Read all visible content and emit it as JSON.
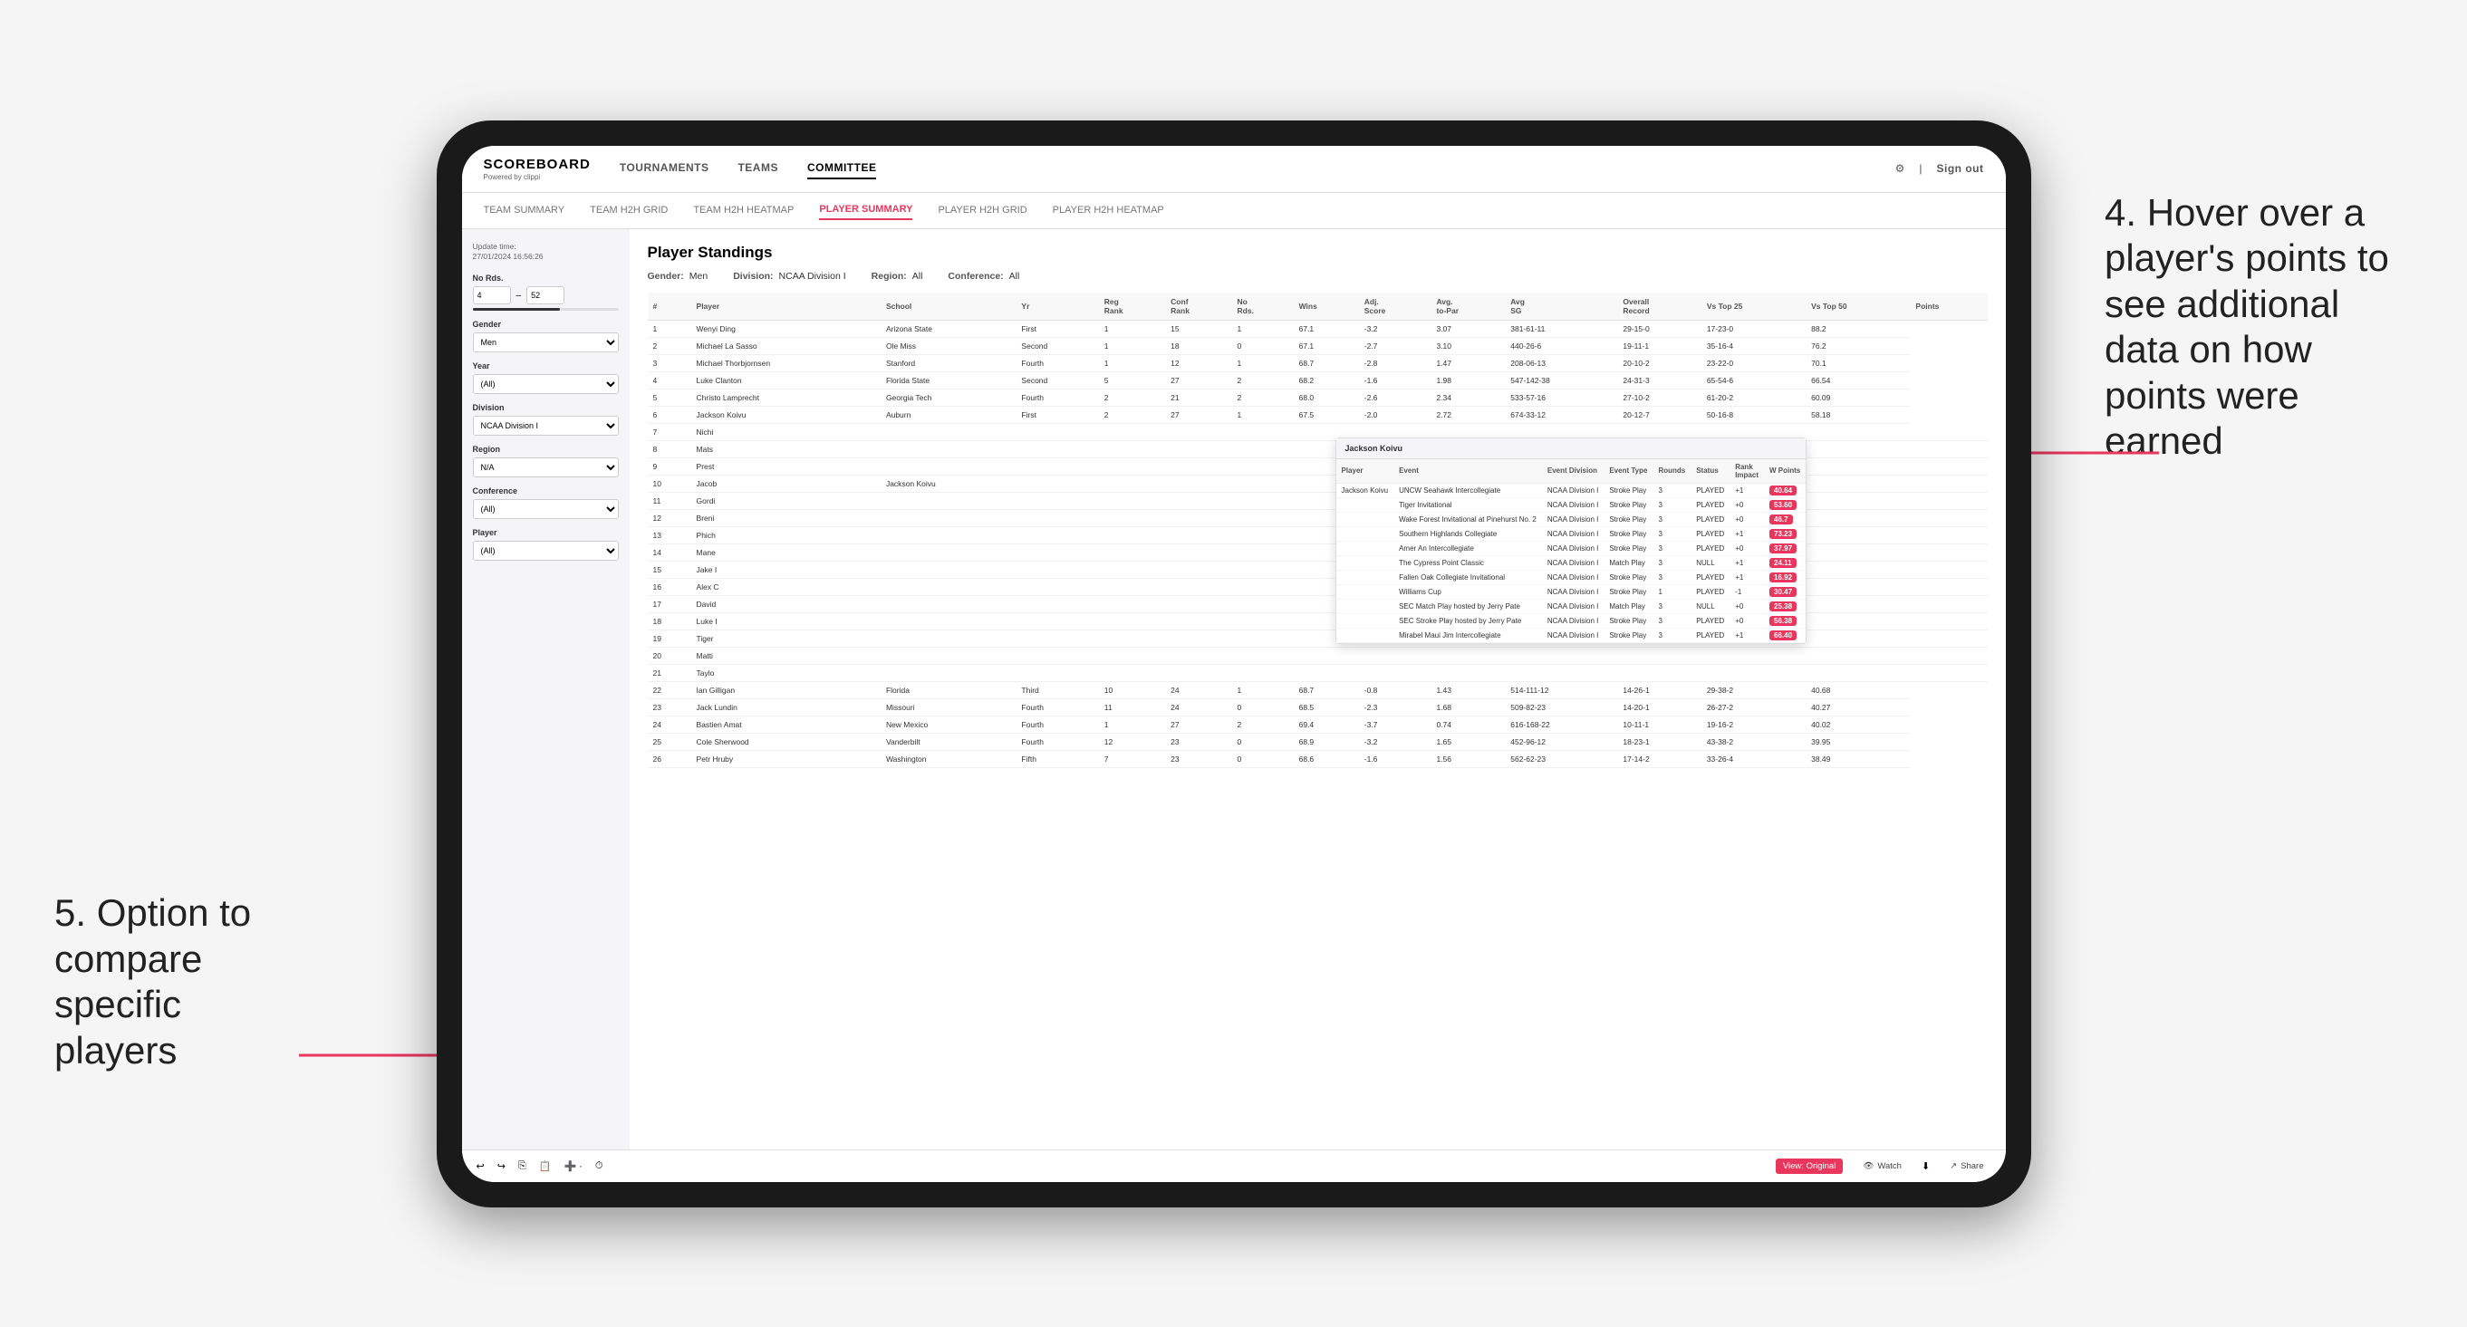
{
  "page": {
    "background": "#f0f0f0"
  },
  "annotation_right": {
    "text": "4. Hover over a player's points to see additional data on how points were earned"
  },
  "annotation_left": {
    "text": "5. Option to compare specific players"
  },
  "nav": {
    "logo": "SCOREBOARD",
    "logo_sub": "Powered by clippi",
    "links": [
      "TOURNAMENTS",
      "TEAMS",
      "COMMITTEE"
    ],
    "active_link": "COMMITTEE",
    "sign_out": "Sign out"
  },
  "sub_nav": {
    "links": [
      "TEAM SUMMARY",
      "TEAM H2H GRID",
      "TEAM H2H HEATMAP",
      "PLAYER SUMMARY",
      "PLAYER H2H GRID",
      "PLAYER H2H HEATMAP"
    ],
    "active": "PLAYER SUMMARY"
  },
  "sidebar": {
    "update_label": "Update time:",
    "update_time": "27/01/2024 16:56:26",
    "no_rds_label": "No Rds.",
    "no_rds_min": "4",
    "no_rds_max": "52",
    "gender_label": "Gender",
    "gender_value": "Men",
    "year_label": "Year",
    "year_value": "(All)",
    "division_label": "Division",
    "division_value": "NCAA Division I",
    "region_label": "Region",
    "region_value": "N/A",
    "conference_label": "Conference",
    "conference_value": "(All)",
    "player_label": "Player",
    "player_value": "(All)"
  },
  "panel": {
    "title": "Player Standings",
    "gender_label": "Gender:",
    "gender_value": "Men",
    "division_label": "Division:",
    "division_value": "NCAA Division I",
    "region_label": "Region:",
    "region_value": "All",
    "conference_label": "Conference:",
    "conference_value": "All"
  },
  "table_headers": [
    "#",
    "Player",
    "School",
    "Yr",
    "Reg Rank",
    "Conf Rank",
    "No Rds.",
    "Wins",
    "Adj. Score",
    "Avg to-Par",
    "Avg SG",
    "Overall Record",
    "Vs Top 25",
    "Vs Top 50",
    "Points"
  ],
  "table_rows": [
    [
      "1",
      "Wenyi Ding",
      "Arizona State",
      "First",
      "1",
      "15",
      "1",
      "67.1",
      "-3.2",
      "3.07",
      "381-61-11",
      "29-15-0",
      "17-23-0",
      "88.2"
    ],
    [
      "2",
      "Michael La Sasso",
      "Ole Miss",
      "Second",
      "1",
      "18",
      "0",
      "67.1",
      "-2.7",
      "3.10",
      "440-26-6",
      "19-11-1",
      "35-16-4",
      "76.2"
    ],
    [
      "3",
      "Michael Thorbjornsen",
      "Stanford",
      "Fourth",
      "1",
      "12",
      "1",
      "68.7",
      "-2.8",
      "1.47",
      "208-06-13",
      "20-10-2",
      "23-22-0",
      "70.1"
    ],
    [
      "4",
      "Luke Clanton",
      "Florida State",
      "Second",
      "5",
      "27",
      "2",
      "68.2",
      "-1.6",
      "1.98",
      "547-142-38",
      "24-31-3",
      "65-54-6",
      "66.54"
    ],
    [
      "5",
      "Christo Lamprecht",
      "Georgia Tech",
      "Fourth",
      "2",
      "21",
      "2",
      "68.0",
      "-2.6",
      "2.34",
      "533-57-16",
      "27-10-2",
      "61-20-2",
      "60.09"
    ],
    [
      "6",
      "Jackson Koivu",
      "Auburn",
      "First",
      "2",
      "27",
      "1",
      "67.5",
      "-2.0",
      "2.72",
      "674-33-12",
      "20-12-7",
      "50-16-8",
      "58.18"
    ],
    [
      "7",
      "Nichi",
      "",
      "",
      "",
      "",
      "",
      "",
      "",
      "",
      "",
      "",
      "",
      "",
      ""
    ],
    [
      "8",
      "Mats",
      "",
      "",
      "",
      "",
      "",
      "",
      "",
      "",
      "",
      "",
      "",
      "",
      ""
    ],
    [
      "9",
      "Prest",
      "",
      "",
      "",
      "",
      "",
      "",
      "",
      "",
      "",
      "",
      "",
      "",
      ""
    ],
    [
      "10",
      "Jacob",
      "Jackson Koivu",
      "",
      "",
      "",
      "",
      "",
      "",
      "",
      "",
      "",
      "",
      "",
      ""
    ],
    [
      "11",
      "Gordi",
      "",
      "",
      "",
      "",
      "",
      "",
      "",
      "",
      "",
      "",
      "",
      "",
      ""
    ],
    [
      "12",
      "Breni",
      "",
      "",
      "",
      "",
      "",
      "",
      "",
      "",
      "",
      "",
      "",
      "",
      ""
    ],
    [
      "13",
      "Phich",
      "",
      "",
      "",
      "",
      "",
      "",
      "",
      "",
      "",
      "",
      "",
      "",
      ""
    ],
    [
      "14",
      "Mane",
      "",
      "",
      "",
      "",
      "",
      "",
      "",
      "",
      "",
      "",
      "",
      "",
      ""
    ],
    [
      "15",
      "Jake I",
      "",
      "",
      "",
      "",
      "",
      "",
      "",
      "",
      "",
      "",
      "",
      "",
      ""
    ],
    [
      "16",
      "Alex C",
      "",
      "",
      "",
      "",
      "",
      "",
      "",
      "",
      "",
      "",
      "",
      "",
      ""
    ],
    [
      "17",
      "David",
      "",
      "",
      "",
      "",
      "",
      "",
      "",
      "",
      "",
      "",
      "",
      "",
      ""
    ],
    [
      "18",
      "Luke I",
      "",
      "",
      "",
      "",
      "",
      "",
      "",
      "",
      "",
      "",
      "",
      "",
      ""
    ],
    [
      "19",
      "Tiger",
      "",
      "",
      "",
      "",
      "",
      "",
      "",
      "",
      "",
      "",
      "",
      "",
      ""
    ],
    [
      "20",
      "Matti",
      "",
      "",
      "",
      "",
      "",
      "",
      "",
      "",
      "",
      "",
      "",
      "",
      ""
    ],
    [
      "21",
      "Taylo",
      "",
      "",
      "",
      "",
      "",
      "",
      "",
      "",
      "",
      "",
      "",
      "",
      ""
    ],
    [
      "22",
      "Ian Gilligan",
      "Florida",
      "Third",
      "10",
      "24",
      "1",
      "68.7",
      "-0.8",
      "1.43",
      "514-111-12",
      "14-26-1",
      "29-38-2",
      "40.68"
    ],
    [
      "23",
      "Jack Lundin",
      "Missouri",
      "Fourth",
      "11",
      "24",
      "0",
      "68.5",
      "-2.3",
      "1.68",
      "509-82-23",
      "14-20-1",
      "26-27-2",
      "40.27"
    ],
    [
      "24",
      "Bastien Amat",
      "New Mexico",
      "Fourth",
      "1",
      "27",
      "2",
      "69.4",
      "-3.7",
      "0.74",
      "616-168-22",
      "10-11-1",
      "19-16-2",
      "40.02"
    ],
    [
      "25",
      "Cole Sherwood",
      "Vanderbilt",
      "Fourth",
      "12",
      "23",
      "0",
      "68.9",
      "-3.2",
      "1.65",
      "452-96-12",
      "18-23-1",
      "43-38-2",
      "39.95"
    ],
    [
      "26",
      "Petr Hruby",
      "Washington",
      "Fifth",
      "7",
      "23",
      "0",
      "68.6",
      "-1.6",
      "1.56",
      "562-62-23",
      "17-14-2",
      "33-26-4",
      "38.49"
    ]
  ],
  "popup": {
    "header": "Jackson Koivu",
    "col_headers": [
      "Player",
      "Event",
      "Event Division",
      "Event Type",
      "Rounds",
      "Status",
      "Rank Impact",
      "W Points"
    ],
    "rows": [
      [
        "Jackson Koivu",
        "UNCW Seahawk Intercollegiate",
        "NCAA Division I",
        "Stroke Play",
        "3",
        "PLAYED",
        "+1",
        "40.64"
      ],
      [
        "",
        "Tiger Invitational",
        "NCAA Division I",
        "Stroke Play",
        "3",
        "PLAYED",
        "+0",
        "53.60"
      ],
      [
        "",
        "Wake Forest Invitational at Pinehurst No. 2",
        "NCAA Division I",
        "Stroke Play",
        "3",
        "PLAYED",
        "+0",
        "46.7"
      ],
      [
        "",
        "Southern Highlands Collegiate",
        "NCAA Division I",
        "Stroke Play",
        "3",
        "PLAYED",
        "+1",
        "73.23"
      ],
      [
        "",
        "Amer An Intercollegiate",
        "NCAA Division I",
        "Stroke Play",
        "3",
        "PLAYED",
        "+0",
        "37.97"
      ],
      [
        "",
        "The Cypress Point Classic",
        "NCAA Division I",
        "Match Play",
        "3",
        "NULL",
        "+1",
        "24.11"
      ],
      [
        "",
        "Fallen Oak Collegiate Invitational",
        "NCAA Division I",
        "Stroke Play",
        "3",
        "PLAYED",
        "+1",
        "16.92"
      ],
      [
        "",
        "Williams Cup",
        "NCAA Division I",
        "Stroke Play",
        "1",
        "PLAYED",
        "-1",
        "30.47"
      ],
      [
        "",
        "SEC Match Play hosted by Jerry Pate",
        "NCAA Division I",
        "Match Play",
        "3",
        "NULL",
        "+0",
        "25.38"
      ],
      [
        "",
        "SEC Stroke Play hosted by Jerry Pate",
        "NCAA Division I",
        "Stroke Play",
        "3",
        "PLAYED",
        "+0",
        "56.38"
      ],
      [
        "",
        "Mirabel Maui Jim Intercollegiate",
        "NCAA Division I",
        "Stroke Play",
        "3",
        "PLAYED",
        "+1",
        "66.40"
      ]
    ]
  },
  "bottom_toolbar": {
    "view_original": "View: Original",
    "watch": "Watch",
    "share": "Share"
  }
}
